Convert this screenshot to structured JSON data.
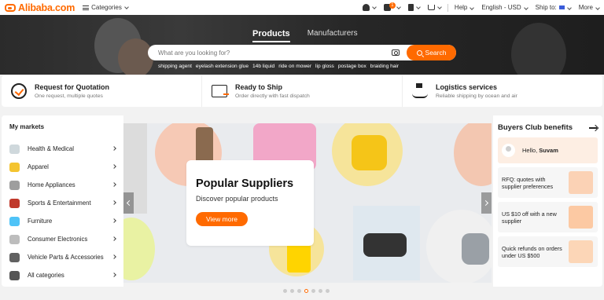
{
  "header": {
    "logo_text": "Alibaba.com",
    "categories_label": "Categories",
    "message_badge": "1",
    "help_label": "Help",
    "language_label": "English - USD",
    "ship_to_label": "Ship to:",
    "more_label": "More"
  },
  "search": {
    "tabs": [
      "Products",
      "Manufacturers"
    ],
    "placeholder": "What are you looking for?",
    "button_label": "Search",
    "suggestions": [
      "shipping agent",
      "eyelash extension glue",
      "14b liquid",
      "ride on mower",
      "lip gloss",
      "postage box",
      "braiding hair"
    ]
  },
  "services": [
    {
      "title": "Request for Quotation",
      "subtitle": "One request, multiple quotes",
      "icon": "rfq-icon"
    },
    {
      "title": "Ready to Ship",
      "subtitle": "Order directly with fast dispatch",
      "icon": "ready-to-ship-icon"
    },
    {
      "title": "Logistics services",
      "subtitle": "Reliable shipping by ocean and air",
      "icon": "logistics-ship-icon"
    }
  ],
  "markets": {
    "title": "My markets",
    "items": [
      {
        "label": "Health & Medical",
        "icon_color": "#cfd8dc"
      },
      {
        "label": "Apparel",
        "icon_color": "#f4c430"
      },
      {
        "label": "Home Appliances",
        "icon_color": "#9e9e9e"
      },
      {
        "label": "Sports & Entertainment",
        "icon_color": "#c0392b"
      },
      {
        "label": "Furniture",
        "icon_color": "#4fc3f7"
      },
      {
        "label": "Consumer Electronics",
        "icon_color": "#bdbdbd"
      },
      {
        "label": "Vehicle Parts & Accessories",
        "icon_color": "#616161"
      },
      {
        "label": "All categories",
        "icon_color": "#555555"
      }
    ]
  },
  "carousel": {
    "title": "Popular Suppliers",
    "subtitle": "Discover popular products",
    "button_label": "View more",
    "active_slide": 3,
    "slide_count": 7
  },
  "buyers_club": {
    "title": "Buyers Club benefits",
    "greeting": "Hello,",
    "user_name": "Suvam",
    "perks": [
      "RFQ: quotes with supplier preferences",
      "US $10 off with a new supplier",
      "Quick refunds on orders under US $500"
    ]
  },
  "colors": {
    "accent": "#ff6a00",
    "hero_bg": "#2b2b2b"
  }
}
